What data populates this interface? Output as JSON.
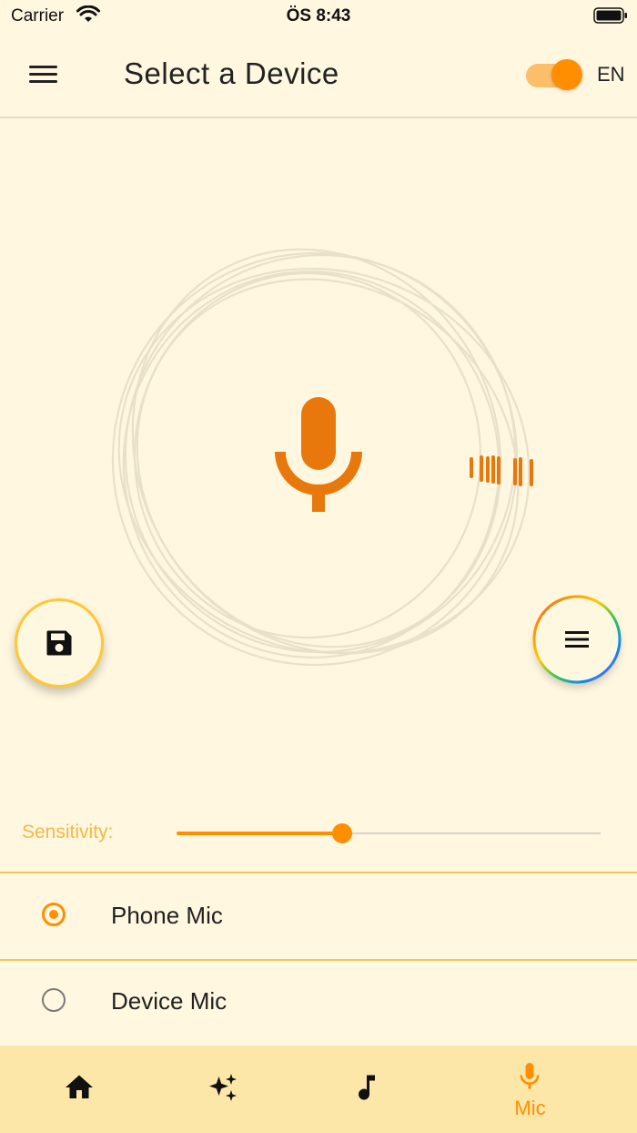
{
  "status_bar": {
    "carrier": "Carrier",
    "time": "ÖS 8:43"
  },
  "header": {
    "title": "Select a Device",
    "language": "EN",
    "language_toggle_on": true
  },
  "sensitivity": {
    "label": "Sensitivity:",
    "value": 0.39
  },
  "mic_sources": [
    {
      "label": "Phone Mic",
      "selected": true
    },
    {
      "label": "Device Mic",
      "selected": false
    }
  ],
  "bottom_nav": {
    "items": [
      {
        "icon": "home-icon",
        "label": ""
      },
      {
        "icon": "sparkles-icon",
        "label": ""
      },
      {
        "icon": "music-note-icon",
        "label": ""
      },
      {
        "icon": "mic-icon",
        "label": "Mic",
        "active": true
      }
    ]
  },
  "colors": {
    "accent": "#ff8f00",
    "mic": "#e8780c",
    "background": "#fff7e0",
    "nav_background": "#fde7a8",
    "save_ring": "#ffc832"
  }
}
